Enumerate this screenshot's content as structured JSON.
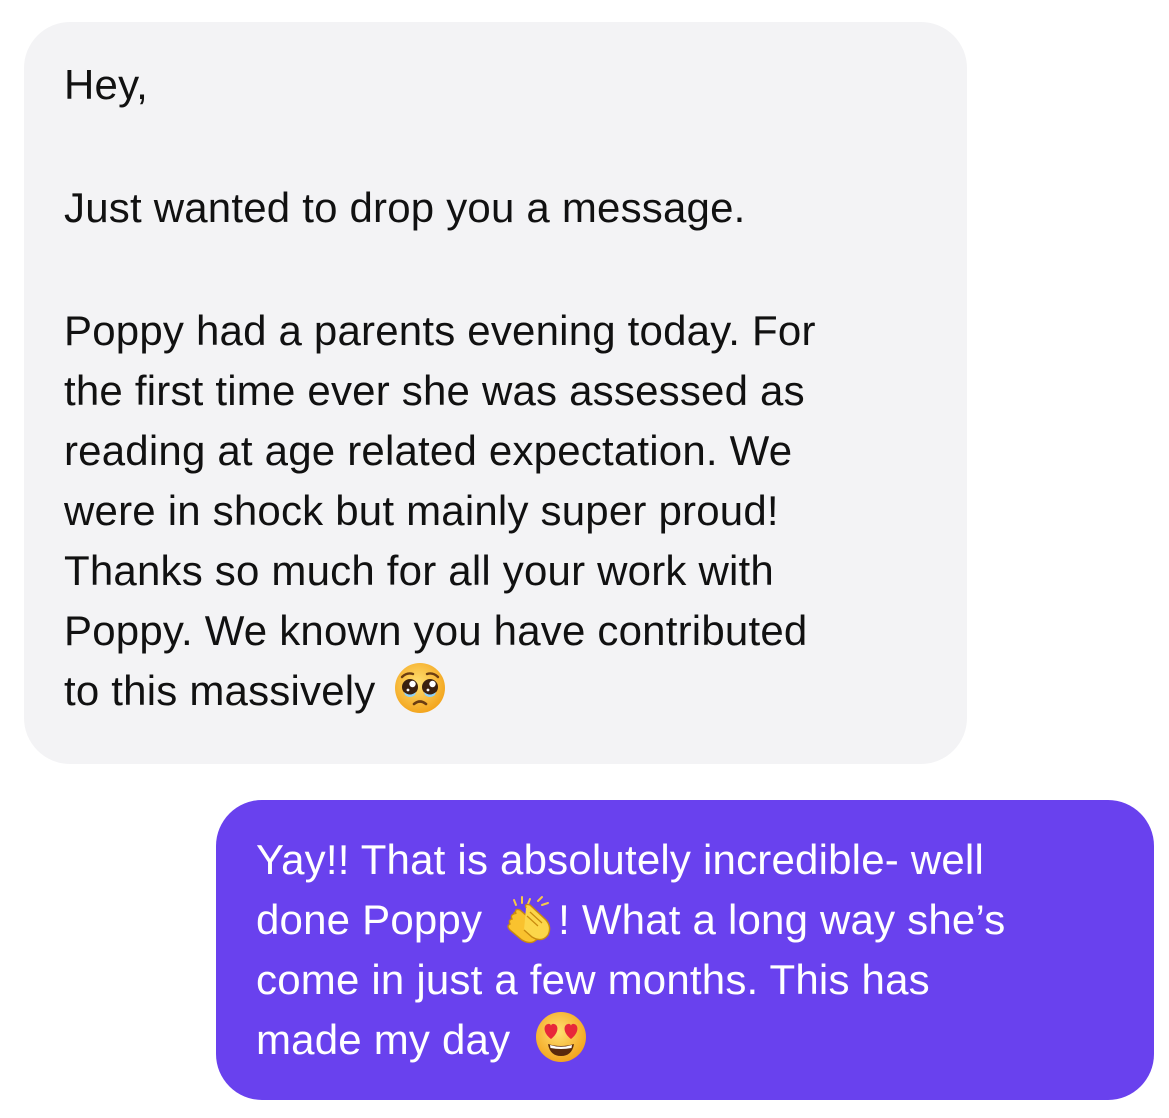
{
  "conversation": {
    "incoming": {
      "paragraphs": [
        [
          "Hey,"
        ],
        [
          "Just wanted to drop you a message."
        ],
        [
          "Poppy had a parents evening today. For",
          "the first time ever she was assessed as",
          "reading at age related expectation. We",
          "were in shock but mainly super proud!",
          "Thanks so much for all your work with",
          "Poppy. We known you have contributed",
          "to this massively"
        ]
      ],
      "trailing_emoji": "pleading-face-icon",
      "bubble_color": "#f3f3f5"
    },
    "outgoing": {
      "line1": "Yay!! That is absolutely incredible- well",
      "line2_before": "done Poppy",
      "line2_after": "! What a long way she’s",
      "line3": "come in just a few months. This has",
      "line4": "made my day",
      "inline_emoji": "clapping-hands-icon",
      "trailing_emoji": "heart-eyes-icon",
      "bubble_color": "#6941ee"
    }
  }
}
